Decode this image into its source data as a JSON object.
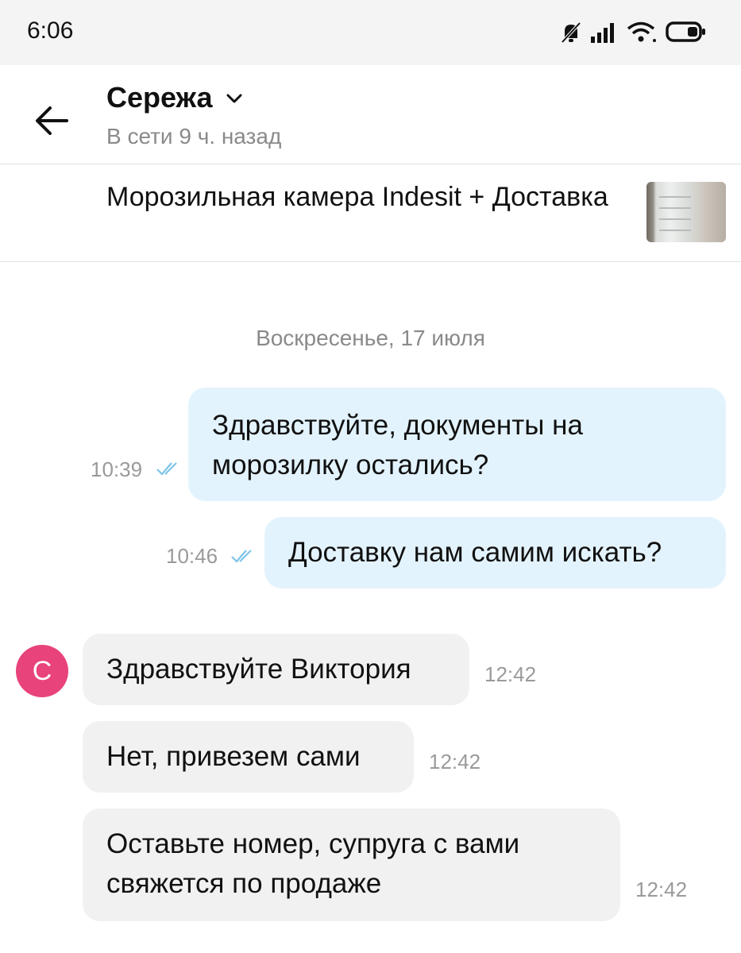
{
  "status_bar": {
    "time": "6:06"
  },
  "header": {
    "contact_name": "Сережа",
    "contact_status": "В сети 9 ч. назад"
  },
  "item": {
    "title": "Морозильная камера Indesit + Доставка"
  },
  "chat": {
    "date_separator": "Воскресенье, 17 июля",
    "avatar_letter": "С",
    "messages": [
      {
        "direction": "out",
        "text": "Здравствуйте, документы на морозилку остались?",
        "time": "10:39"
      },
      {
        "direction": "out",
        "text": "Доставку нам самим искать?",
        "time": "10:46"
      },
      {
        "direction": "in",
        "text": "Здравствуйте Виктория",
        "time": "12:42"
      },
      {
        "direction": "in",
        "text": "Нет, привезем сами",
        "time": "12:42"
      },
      {
        "direction": "in",
        "text": "Оставьте номер, супруга с вами свяжется по продаже",
        "time": "12:42"
      }
    ]
  },
  "colors": {
    "outgoing_bubble": "#e3f3fd",
    "incoming_bubble": "#f1f1f1",
    "avatar": "#e8437a",
    "read_check": "#7cc4ea"
  },
  "icons": [
    "back-arrow-icon",
    "chevron-down-icon",
    "mute-bell-icon",
    "signal-icon",
    "wifi-icon",
    "battery-icon",
    "double-check-icon"
  ]
}
